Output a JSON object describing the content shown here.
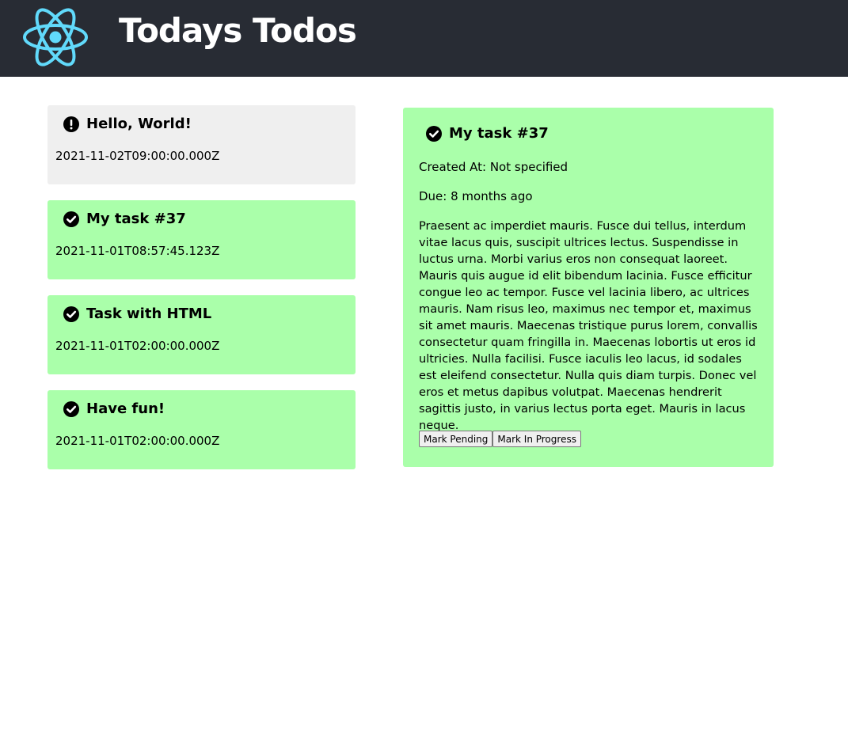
{
  "header": {
    "title": "Todays Todos",
    "logo_icon": "react-atom-icon",
    "background": "#282c34",
    "logo_color": "#61dafb"
  },
  "todos": [
    {
      "title": "Hello, World!",
      "date": "2021-11-02T09:00:00.000Z",
      "status": "pending",
      "icon": "exclamation-circle-icon",
      "color": "#efefef"
    },
    {
      "title": "My task #37",
      "date": "2021-11-01T08:57:45.123Z",
      "status": "done",
      "icon": "check-circle-icon",
      "color": "#aaffaa"
    },
    {
      "title": "Task with HTML",
      "date": "2021-11-01T02:00:00.000Z",
      "status": "done",
      "icon": "check-circle-icon",
      "color": "#aaffaa"
    },
    {
      "title": "Have fun!",
      "date": "2021-11-01T02:00:00.000Z",
      "status": "done",
      "icon": "check-circle-icon",
      "color": "#aaffaa"
    }
  ],
  "detail": {
    "title": "My task #37",
    "icon": "check-circle-icon",
    "created": "Created At: Not specified",
    "due": "Due: 8 months ago",
    "body": "Praesent ac imperdiet mauris. Fusce dui tellus, interdum vitae lacus quis, suscipit ultrices lectus. Suspendisse in luctus urna. Morbi varius eros non consequat laoreet. Mauris quis augue id elit bibendum lacinia. Fusce efficitur congue leo ac tempor. Fusce vel lacinia libero, ac ultrices mauris. Nam risus leo, maximus nec tempor et, maximus sit amet mauris. Maecenas tristique purus lorem, convallis consectetur quam fringilla in. Maecenas lobortis ut eros id ultricies. Nulla facilisi. Fusce iaculis leo lacus, id sodales est eleifend consectetur. Nulla quis diam turpis. Donec vel eros et metus dapibus volutpat. Maecenas hendrerit sagittis justo, in varius lectus porta eget. Mauris in lacus neque.",
    "mark_pending_label": "Mark Pending",
    "mark_in_progress_label": "Mark In Progress",
    "color": "#aaffaa"
  }
}
